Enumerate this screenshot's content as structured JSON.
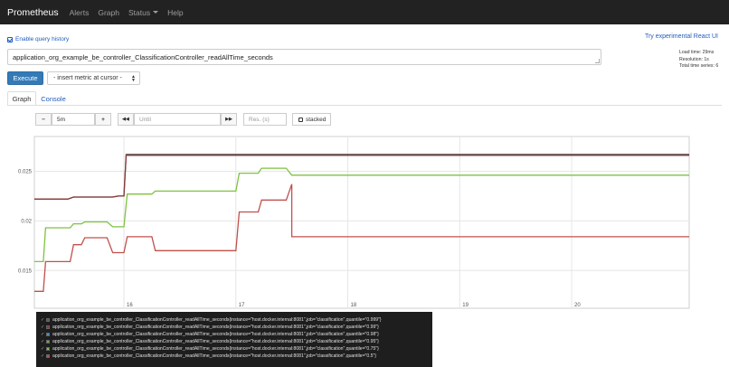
{
  "nav": {
    "brand": "Prometheus",
    "items": [
      {
        "label": "Alerts"
      },
      {
        "label": "Graph"
      },
      {
        "label": "Status"
      },
      {
        "label": "Help"
      }
    ]
  },
  "enable_history_label": "Enable query history",
  "react_ui_link": "Try experimental React UI",
  "query": "application_org_example_be_controller_ClassificationController_readAllTime_seconds",
  "stats": {
    "load_time": "Load time: 29ms",
    "resolution": "Resolution: 1s",
    "total_series": "Total time series: 6"
  },
  "execute_label": "Execute",
  "metric_select_label": "- insert metric at cursor -",
  "tabs": {
    "graph": "Graph",
    "console": "Console"
  },
  "controls": {
    "minus": "−",
    "range": "5m",
    "plus": "+",
    "back": "◀◀",
    "until_placeholder": "Until",
    "forward": "▶▶",
    "res_placeholder": "Res. (s)",
    "stacked_label": "stacked"
  },
  "icons": {
    "history": "checkbox-icon",
    "select": "updown-icon",
    "stacked": "checkbox-icon"
  },
  "chart_data": {
    "type": "line",
    "x_ticks": [
      "16",
      "17",
      "18",
      "19",
      "20"
    ],
    "x_tick_values": [
      16,
      17,
      18,
      19,
      20
    ],
    "xlim": [
      15.2,
      21.05
    ],
    "y_ticks": [
      "0.015",
      "0.02",
      "0.025"
    ],
    "y_tick_values": [
      0.015,
      0.02,
      0.025
    ],
    "ylim": [
      0.0112,
      0.0285
    ],
    "grid": true,
    "series": [
      {
        "name": "application_org_example_be_controller_ClassificationController_readAllTime_seconds{instance=\"host.docker.internal:8081\",job=\"classification\",quantile=\"0.999\"}",
        "color": "#5a5a5a",
        "points": [
          [
            15.2,
            0.0222
          ],
          [
            15.5,
            0.0222
          ],
          [
            15.55,
            0.0224
          ],
          [
            15.9,
            0.0224
          ],
          [
            15.95,
            0.0225
          ],
          [
            16.0,
            0.0225
          ],
          [
            16.02,
            0.0267
          ],
          [
            21.05,
            0.0267
          ]
        ]
      },
      {
        "name": "application_org_example_be_controller_ClassificationController_readAllTime_seconds{instance=\"host.docker.internal:8081\",job=\"classification\",quantile=\"0.99\"}",
        "color": "#8b3a3a",
        "points": [
          [
            15.2,
            0.0222
          ],
          [
            15.5,
            0.0222
          ],
          [
            15.55,
            0.0224
          ],
          [
            15.9,
            0.0224
          ],
          [
            15.95,
            0.0225
          ],
          [
            16.0,
            0.0225
          ],
          [
            16.02,
            0.0266
          ],
          [
            21.05,
            0.0266
          ]
        ]
      },
      {
        "name": "application_org_example_be_controller_ClassificationController_readAllTime_seconds{instance=\"host.docker.internal:8081\",job=\"classification\",quantile=\"0.98\"}",
        "color": "#4a90d9",
        "points": []
      },
      {
        "name": "application_org_example_be_controller_ClassificationController_readAllTime_seconds{instance=\"host.docker.internal:8081\",job=\"classification\",quantile=\"0.95\"}",
        "color": "#6aa84f",
        "points": []
      },
      {
        "name": "application_org_example_be_controller_ClassificationController_readAllTime_seconds{instance=\"host.docker.internal:8081\",job=\"classification\",quantile=\"0.75\"}",
        "color": "#7fc241",
        "points": [
          [
            15.2,
            0.0159
          ],
          [
            15.28,
            0.0159
          ],
          [
            15.3,
            0.0193
          ],
          [
            15.52,
            0.0193
          ],
          [
            15.55,
            0.0197
          ],
          [
            15.62,
            0.0197
          ],
          [
            15.65,
            0.0199
          ],
          [
            15.85,
            0.0199
          ],
          [
            15.9,
            0.0194
          ],
          [
            16.0,
            0.0194
          ],
          [
            16.03,
            0.0227
          ],
          [
            16.25,
            0.0227
          ],
          [
            16.28,
            0.023
          ],
          [
            17.0,
            0.023
          ],
          [
            17.03,
            0.0248
          ],
          [
            17.2,
            0.0248
          ],
          [
            17.23,
            0.0253
          ],
          [
            17.45,
            0.0253
          ],
          [
            17.5,
            0.0246
          ],
          [
            21.05,
            0.0246
          ]
        ]
      },
      {
        "name": "application_org_example_be_controller_ClassificationController_readAllTime_seconds{instance=\"host.docker.internal:8081\",job=\"classification\",quantile=\"0.5\"}",
        "color": "#c0504d",
        "points": [
          [
            15.2,
            0.0129
          ],
          [
            15.28,
            0.0129
          ],
          [
            15.3,
            0.0159
          ],
          [
            15.52,
            0.0159
          ],
          [
            15.55,
            0.0176
          ],
          [
            15.62,
            0.0176
          ],
          [
            15.65,
            0.0183
          ],
          [
            15.85,
            0.0183
          ],
          [
            15.9,
            0.0168
          ],
          [
            16.0,
            0.0168
          ],
          [
            16.03,
            0.0184
          ],
          [
            16.25,
            0.0184
          ],
          [
            16.28,
            0.017
          ],
          [
            17.0,
            0.017
          ],
          [
            17.03,
            0.0209
          ],
          [
            17.2,
            0.0209
          ],
          [
            17.23,
            0.0221
          ],
          [
            17.45,
            0.0221
          ],
          [
            17.5,
            0.0237
          ],
          [
            17.5,
            0.0184
          ],
          [
            21.05,
            0.0184
          ]
        ]
      }
    ]
  }
}
